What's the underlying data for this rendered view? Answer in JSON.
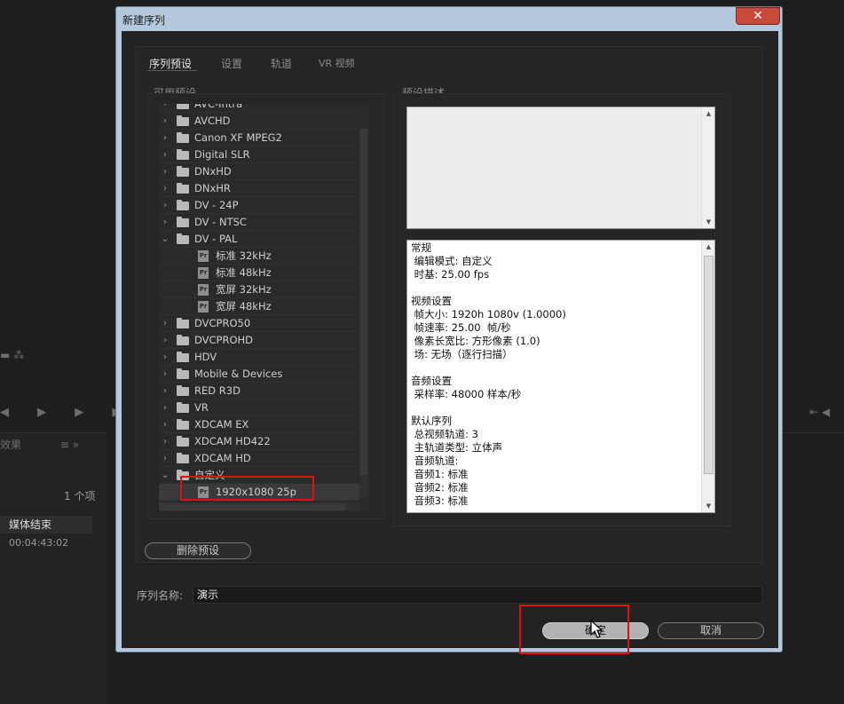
{
  "background": {
    "panel_tab": "效果",
    "item_count": "1 个项",
    "column_header": "媒体结束",
    "column_value": "00:04:43:02"
  },
  "dialog": {
    "title": "新建序列",
    "close_label": "✕",
    "tabs": [
      {
        "label": "序列预设"
      },
      {
        "label": "设置"
      },
      {
        "label": "轨道"
      },
      {
        "label": "VR 视频"
      }
    ],
    "available_presets_title": "可用预设",
    "preset_description_title": "预设描述",
    "tree_items": [
      {
        "label": "AVC-Intra",
        "type": "folder",
        "state": "collapsed"
      },
      {
        "label": "AVCHD",
        "type": "folder",
        "state": "collapsed"
      },
      {
        "label": "Canon XF MPEG2",
        "type": "folder",
        "state": "collapsed"
      },
      {
        "label": "Digital SLR",
        "type": "folder",
        "state": "collapsed"
      },
      {
        "label": "DNxHD",
        "type": "folder",
        "state": "collapsed"
      },
      {
        "label": "DNxHR",
        "type": "folder",
        "state": "collapsed"
      },
      {
        "label": "DV - 24P",
        "type": "folder",
        "state": "collapsed"
      },
      {
        "label": "DV - NTSC",
        "type": "folder",
        "state": "collapsed"
      },
      {
        "label": "DV - PAL",
        "type": "folder",
        "state": "expanded"
      },
      {
        "label": "标准 32kHz",
        "type": "preset"
      },
      {
        "label": "标准 48kHz",
        "type": "preset"
      },
      {
        "label": "宽屏 32kHz",
        "type": "preset"
      },
      {
        "label": "宽屏 48kHz",
        "type": "preset"
      },
      {
        "label": "DVCPRO50",
        "type": "folder",
        "state": "collapsed"
      },
      {
        "label": "DVCPROHD",
        "type": "folder",
        "state": "collapsed"
      },
      {
        "label": "HDV",
        "type": "folder",
        "state": "collapsed"
      },
      {
        "label": "Mobile & Devices",
        "type": "folder",
        "state": "collapsed"
      },
      {
        "label": "RED R3D",
        "type": "folder",
        "state": "collapsed"
      },
      {
        "label": "VR",
        "type": "folder",
        "state": "collapsed"
      },
      {
        "label": "XDCAM EX",
        "type": "folder",
        "state": "collapsed"
      },
      {
        "label": "XDCAM HD422",
        "type": "folder",
        "state": "collapsed"
      },
      {
        "label": "XDCAM HD",
        "type": "folder",
        "state": "collapsed"
      },
      {
        "label": "自定义",
        "type": "folder",
        "state": "expanded"
      },
      {
        "label": "1920x1080 25p",
        "type": "preset",
        "selected": true
      }
    ],
    "preset_icon_text": "Pr",
    "description_text": "常规\n 编辑模式: 自定义\n 时基: 25.00 fps\n\n视频设置\n 帧大小: 1920h 1080v (1.0000)\n 帧速率: 25.00  帧/秒\n 像素长宽比: 方形像素 (1.0)\n 场: 无场（逐行扫描）\n\n音频设置\n 采样率: 48000 样本/秒\n\n默认序列\n 总视频轨道: 3\n 主轨道类型: 立体声\n 音频轨道:\n 音频1: 标准\n 音频2: 标准\n 音频3: 标准",
    "delete_preset_label": "删除预设",
    "sequence_name_label": "序列名称:",
    "sequence_name_value": "演示",
    "ok_label": "确定",
    "cancel_label": "取消"
  },
  "colors": {
    "highlight": "#e01010",
    "dialog_frame": "#b4c9dd",
    "close_button": "#c74a3a"
  }
}
